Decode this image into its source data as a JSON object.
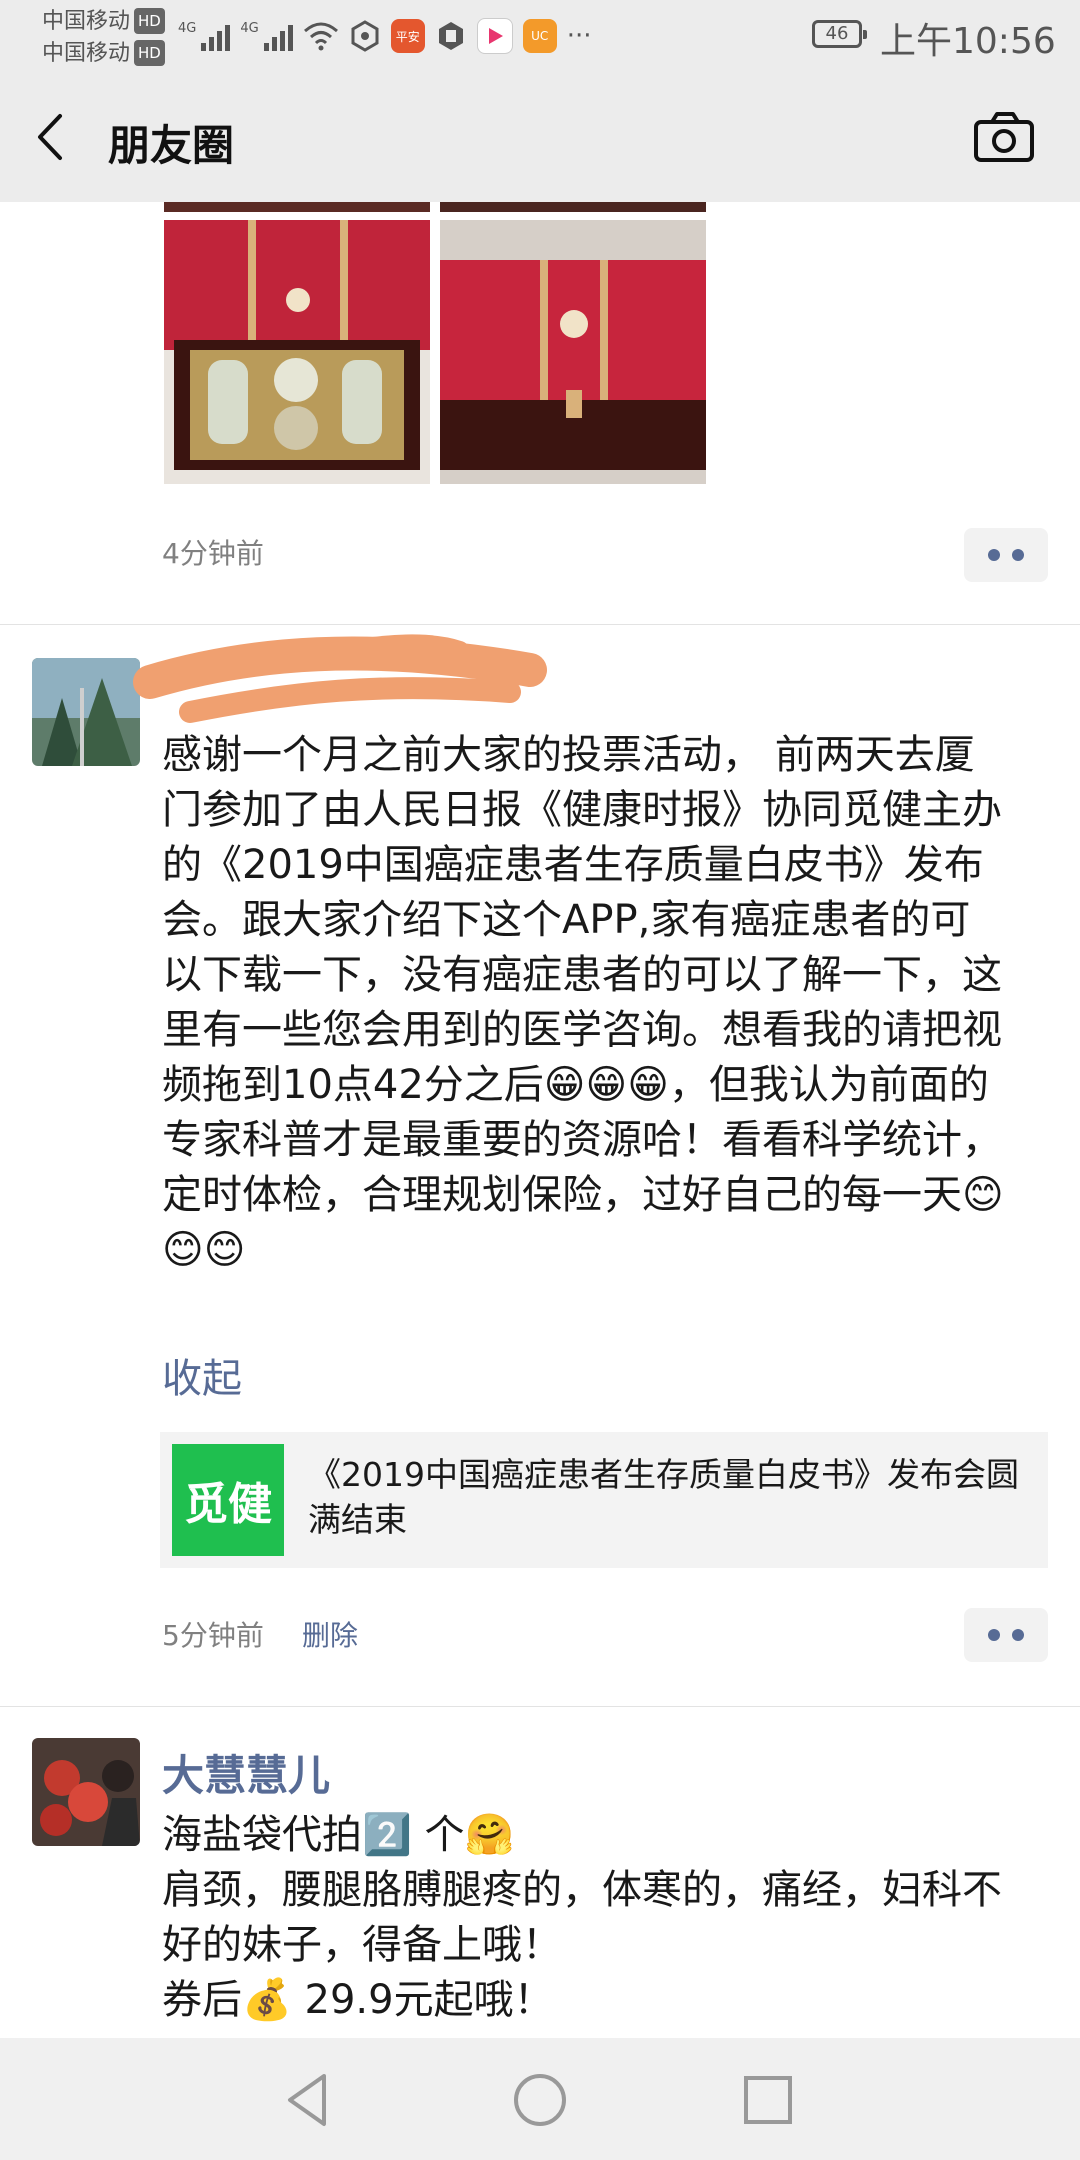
{
  "status_bar": {
    "carrier_1": "中国移动",
    "carrier_2": "中国移动",
    "hd_badge": "HD",
    "network_1": "4G",
    "network_2": "4G",
    "battery": "46",
    "time": "上午10:56",
    "more_icons": "···"
  },
  "header": {
    "title": "朋友圈",
    "back_icon": "back-arrow-icon",
    "camera_icon": "camera-icon"
  },
  "posts": [
    {
      "timestamp": "4分钟前",
      "images": [
        "gift-box-open",
        "gift-box-closed"
      ]
    },
    {
      "author": "",
      "text": "感谢一个月之前大家的投票活动， 前两天去厦门参加了由人民日报《健康时报》协同觅健主办的《2019中国癌症患者生存质量白皮书》发布会。跟大家介绍下这个APP,家有癌症患者的可以下载一下，没有癌症患者的可以了解一下，这里有一些您会用到的医学咨询。想看我的请把视频拖到10点42分之后😁😁😁，但我认为前面的专家科普才是最重要的资源哈！看看科学统计，定时体检，合理规划保险，过好自己的每一天😊😊😊",
      "collapse_label": "收起",
      "link_card": {
        "thumb_text": "觅健",
        "title": "《2019中国癌症患者生存质量白皮书》发布会圆满结束"
      },
      "timestamp": "5分钟前",
      "delete_label": "删除"
    },
    {
      "author": "大慧慧儿",
      "text": "海盐袋代拍2️⃣ 个🤗\n肩颈，腰腿胳膊腿疼的，体寒的，痛经，妇科不好的妹子，得备上哦！\n券后💰 29.9元起哦！"
    }
  ],
  "colors": {
    "link_blue": "#576b95",
    "header_bg": "#ececec",
    "brand_green": "#1fbf4f"
  }
}
